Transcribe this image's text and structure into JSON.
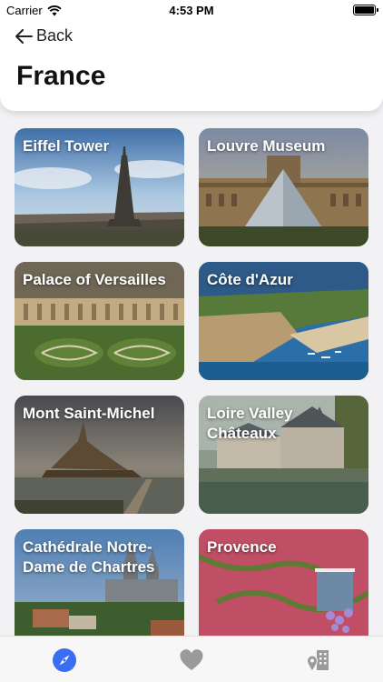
{
  "status_bar": {
    "carrier": "Carrier",
    "time": "4:53 PM"
  },
  "header": {
    "back_label": "Back",
    "title": "France"
  },
  "places": [
    {
      "name": "Eiffel Tower"
    },
    {
      "name": "Louvre Museum"
    },
    {
      "name": "Palace of Versailles"
    },
    {
      "name": "Côte d'Azur"
    },
    {
      "name": "Mont Saint-Michel"
    },
    {
      "name": "Loire Valley Châteaux"
    },
    {
      "name": "Cathédrale Notre-Dame de Chartres"
    },
    {
      "name": "Provence"
    }
  ],
  "tabbar": {
    "tabs": [
      {
        "icon": "compass-icon",
        "active": true
      },
      {
        "icon": "heart-icon",
        "active": false
      },
      {
        "icon": "map-pin-building-icon",
        "active": false
      }
    ],
    "accent_color": "#3a6cf4",
    "inactive_color": "#9a9a9a"
  }
}
